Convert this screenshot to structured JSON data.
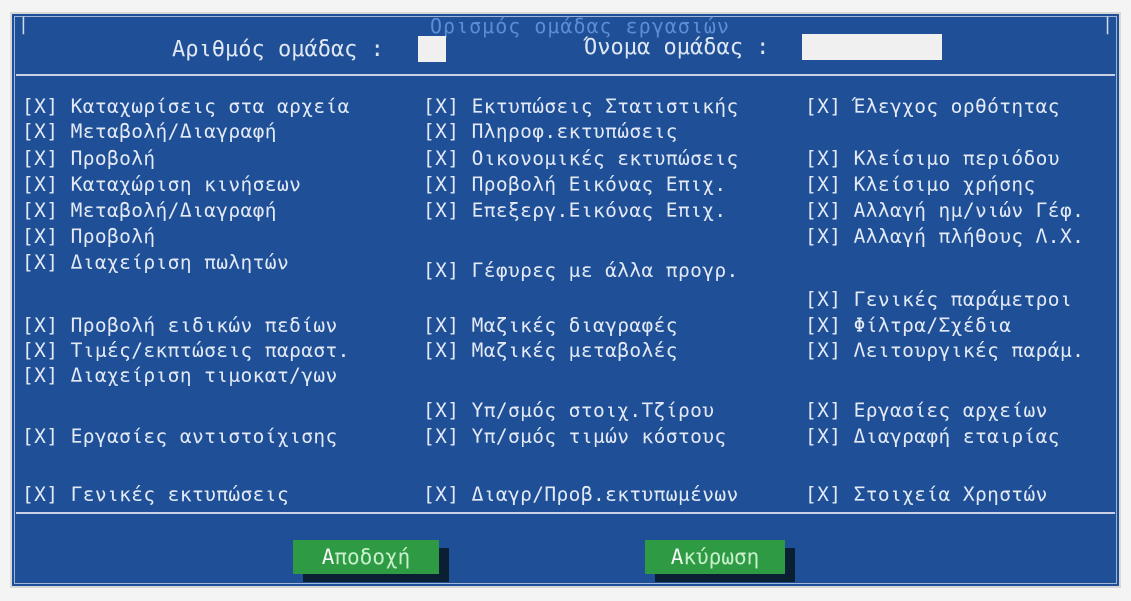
{
  "window": {
    "title": "Ορισμός ομάδας εργασιών",
    "corner_left": "|",
    "corner_right": "|"
  },
  "header": {
    "group_number_label": "Αριθμός ομάδας :",
    "group_number_value": "",
    "group_name_label": "Όνομα ομάδας :",
    "group_name_value": ""
  },
  "checkbox_mark": "[X]",
  "permissions": [
    {
      "label": "Καταχωρίσεις στα αρχεία"
    },
    {
      "label": "Μεταβολή/Διαγραφή"
    },
    {
      "label": "Προβολή"
    },
    {
      "label": "Καταχώριση κινήσεων"
    },
    {
      "label": "Μεταβολή/Διαγραφή"
    },
    {
      "label": "Προβολή"
    },
    {
      "label": "Διαχείριση πωλητών"
    },
    {
      "label": "Προβολή ειδικών πεδίων"
    },
    {
      "label": "Τιμές/εκπτώσεις παραστ."
    },
    {
      "label": "Διαχείριση τιμοκατ/γων"
    },
    {
      "label": "Εργασίες αντιστοίχισης"
    },
    {
      "label": "Γενικές εκτυπώσεις"
    },
    {
      "label": "Εκτυπώσεις Στατιστικής"
    },
    {
      "label": "Πληροφ.εκτυπώσεις"
    },
    {
      "label": "Οικονομικές εκτυπώσεις"
    },
    {
      "label": "Προβολή Εικόνας Επιχ."
    },
    {
      "label": "Επεξεργ.Εικόνας Επιχ."
    },
    {
      "label": "Γέφυρες με άλλα προγρ."
    },
    {
      "label": "Μαζικές διαγραφές"
    },
    {
      "label": "Μαζικές μεταβολές"
    },
    {
      "label": "Υπ/σμός στοιχ.Τζίρου"
    },
    {
      "label": "Υπ/σμός τιμών κόστους"
    },
    {
      "label": "Διαγρ/Προβ.εκτυπωμένων"
    },
    {
      "label": "Έλεγχος ορθότητας"
    },
    {
      "label": "Κλείσιμο περιόδου"
    },
    {
      "label": "Κλείσιμο χρήσης"
    },
    {
      "label": "Αλλαγή ημ/νιών Γέφ."
    },
    {
      "label": "Αλλαγή πλήθους Λ.Χ."
    },
    {
      "label": "Γενικές παράμετροι"
    },
    {
      "label": "Φίλτρα/Σχέδια"
    },
    {
      "label": "Λειτουργικές παράμ."
    },
    {
      "label": "Εργασίες αρχείων"
    },
    {
      "label": "Διαγραφή εταιρίας"
    },
    {
      "label": "Στοιχεία Χρηστών"
    }
  ],
  "buttons": {
    "accept": {
      "hotkey": "Α",
      "rest": "ποδοχή"
    },
    "cancel": {
      "hotkey": "Α",
      "rest": "κύρωση"
    }
  }
}
